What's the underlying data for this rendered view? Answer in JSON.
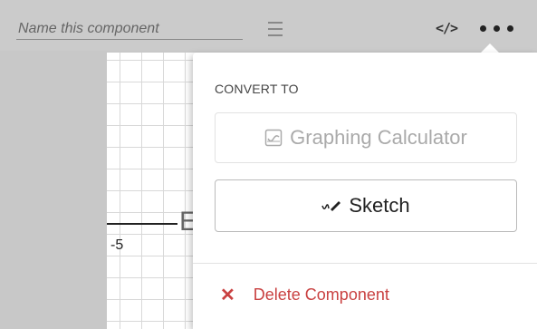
{
  "header": {
    "name_placeholder": "Name this component",
    "code_icon": "</>"
  },
  "graph": {
    "tick_label": "-5",
    "partial_glyph": "E"
  },
  "popover": {
    "section_title": "CONVERT TO",
    "graphing_label": "Graphing Calculator",
    "sketch_label": "Sketch",
    "delete_label": "Delete Component",
    "delete_icon": "✕"
  },
  "colors": {
    "delete": "#c94141",
    "disabled_text": "#aaaaaa"
  }
}
